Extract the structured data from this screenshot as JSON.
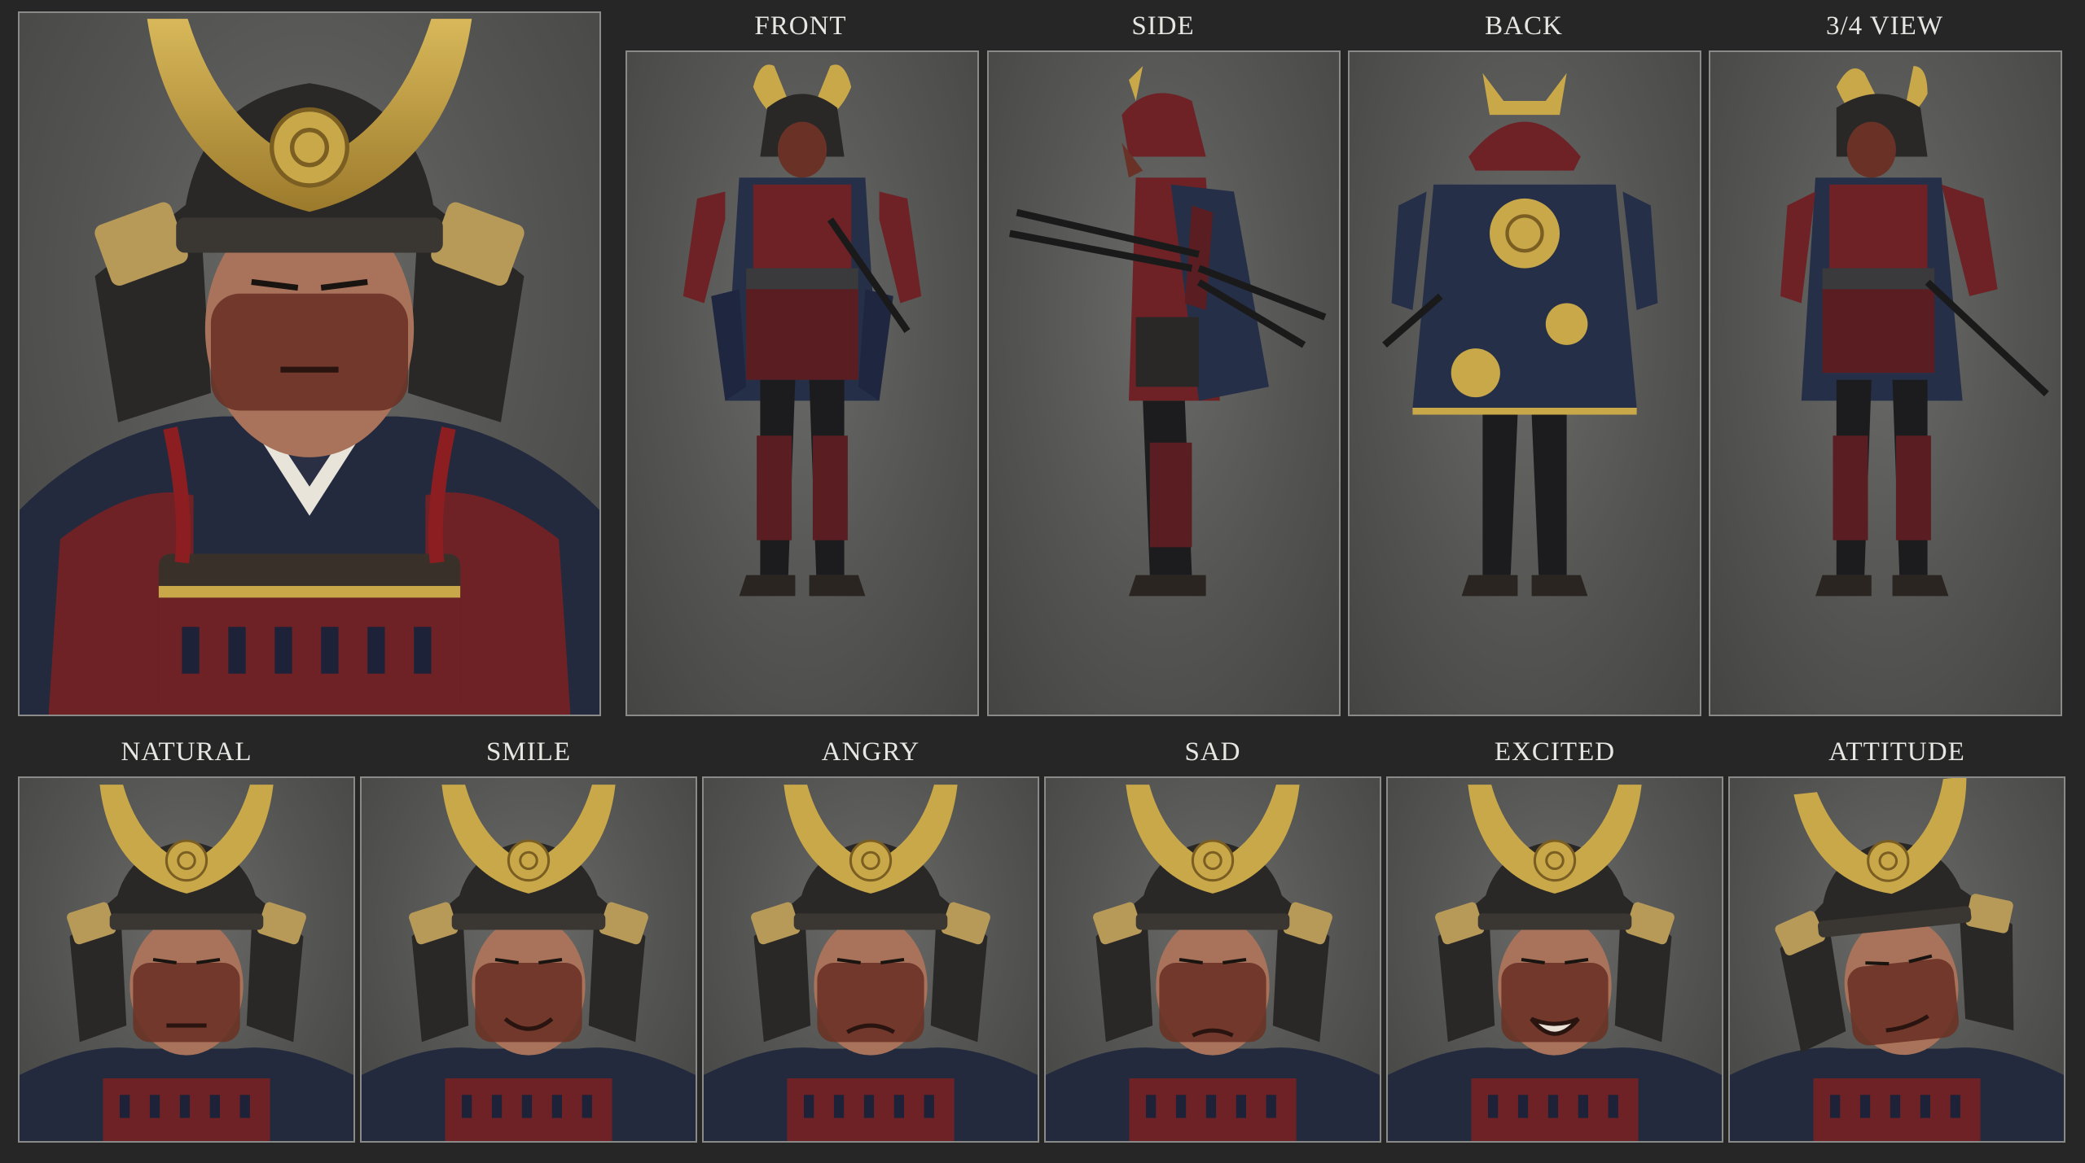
{
  "sheet": {
    "views": [
      {
        "label": "FRONT",
        "pose": "front"
      },
      {
        "label": "SIDE",
        "pose": "side"
      },
      {
        "label": "BACK",
        "pose": "back"
      },
      {
        "label": "3/4 VIEW",
        "pose": "three-quarter"
      }
    ],
    "expressions": [
      {
        "label": "NATURAL",
        "mouth": "neutral"
      },
      {
        "label": "SMILE",
        "mouth": "smile"
      },
      {
        "label": "ANGRY",
        "mouth": "frown"
      },
      {
        "label": "SAD",
        "mouth": "down"
      },
      {
        "label": "EXCITED",
        "mouth": "open"
      },
      {
        "label": "ATTITUDE",
        "mouth": "smirk"
      }
    ]
  },
  "colors": {
    "background": "#262626",
    "panel": "#585856",
    "gold": "#c9a84a",
    "lacquer_red": "#6e2226",
    "navy": "#252f48",
    "iron": "#2a2826",
    "skin": "#a8735a"
  }
}
